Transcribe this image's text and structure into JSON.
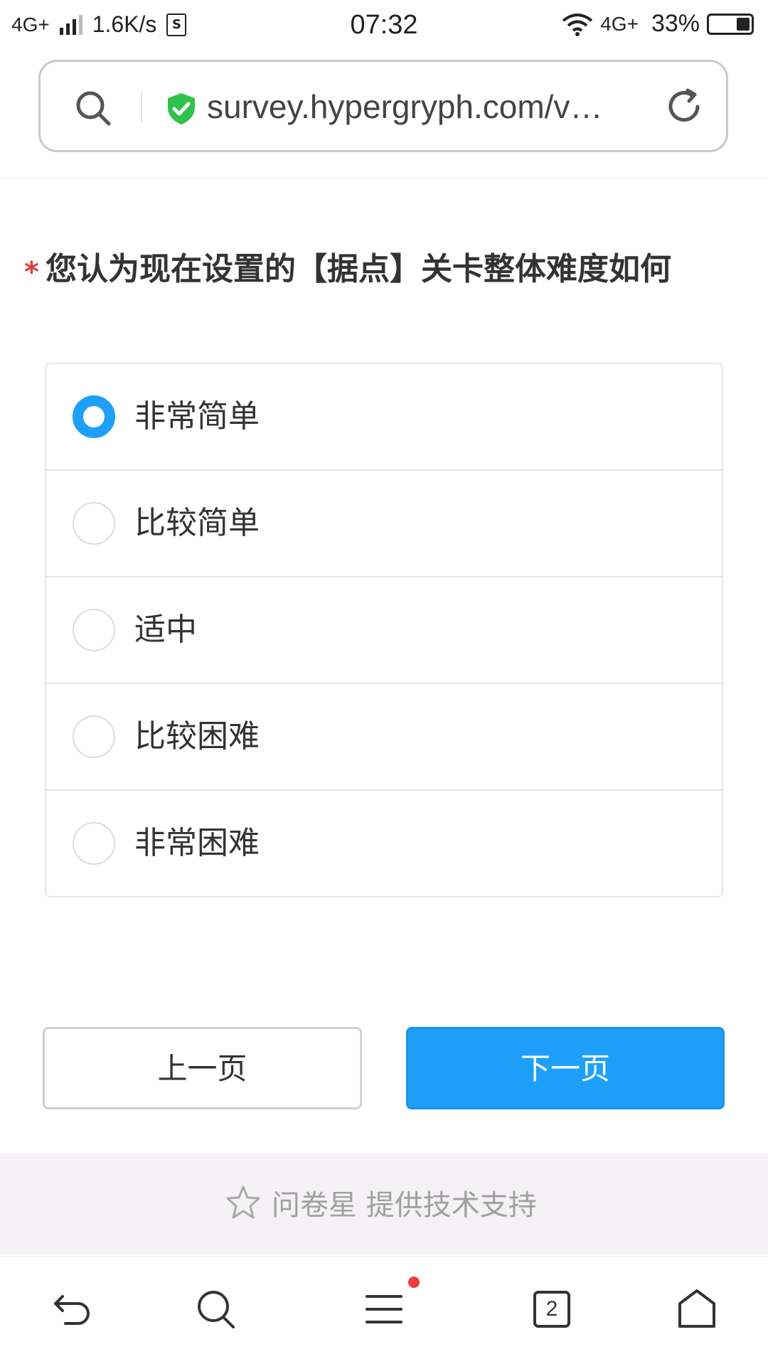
{
  "status_bar": {
    "network_left": "4G+",
    "speed": "1.6K/s",
    "sim_label": "S",
    "time": "07:32",
    "network_right": "4G+",
    "battery_percent": "33%",
    "battery_level": 0.33
  },
  "address_bar": {
    "url": "survey.hypergryph.com/v…",
    "search_icon": "search-icon",
    "secure_icon": "shield-check-icon",
    "reload_icon": "reload-icon"
  },
  "question": {
    "required_mark": "*",
    "title": "您认为现在设置的【据点】关卡整体难度如何"
  },
  "options": [
    {
      "label": "非常简单",
      "selected": true
    },
    {
      "label": "比较简单",
      "selected": false
    },
    {
      "label": "适中",
      "selected": false
    },
    {
      "label": "比较困难",
      "selected": false
    },
    {
      "label": "非常困难",
      "selected": false
    }
  ],
  "buttons": {
    "prev_label": "上一页",
    "next_label": "下一页"
  },
  "footer": {
    "powered_text": "问卷星 提供技术支持",
    "icon": "star-icon"
  },
  "bottom_nav": {
    "tab_count": "2",
    "icons": [
      "back-icon",
      "search-icon",
      "menu-icon",
      "tabs-icon",
      "home-icon"
    ]
  },
  "colors": {
    "accent": "#1ea0fa",
    "required": "#e4393c",
    "secure_green": "#2fc24b",
    "notification_dot": "#f03c3c"
  }
}
